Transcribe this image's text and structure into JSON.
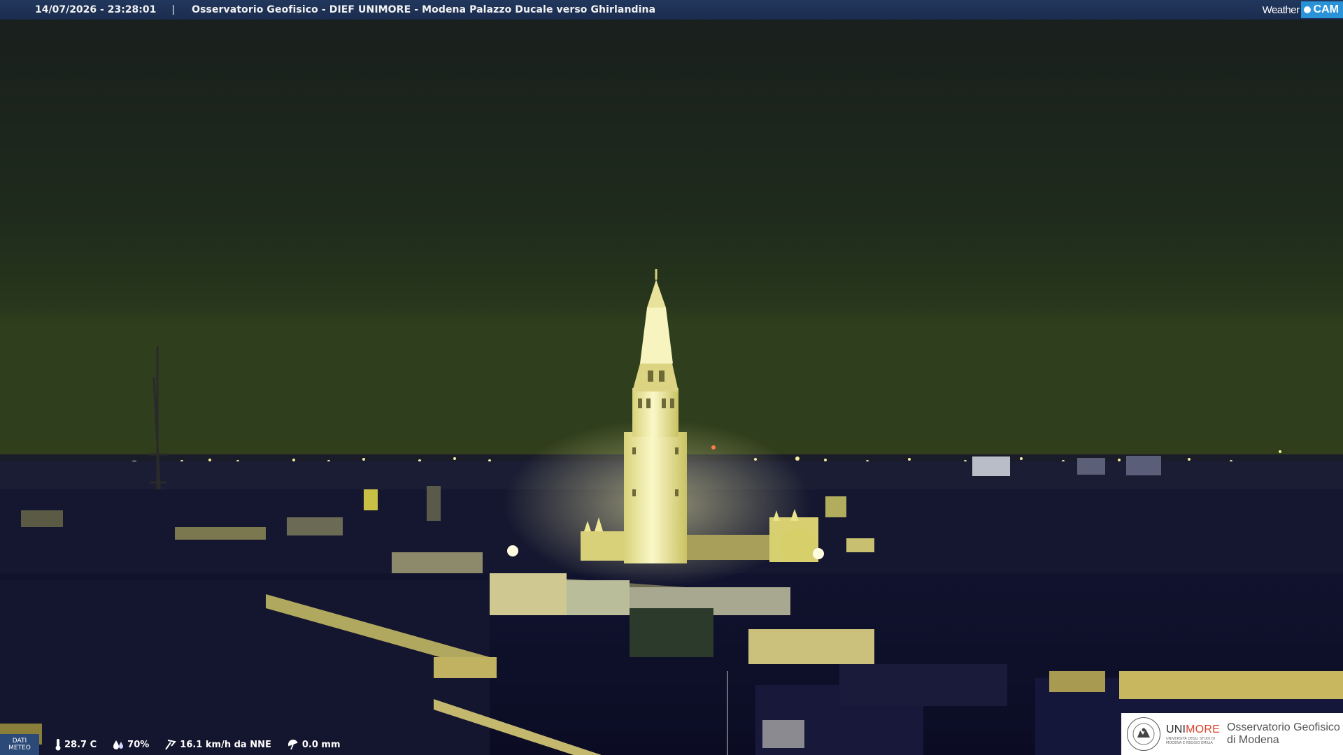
{
  "header": {
    "datetime": "14/07/2026 - 23:28:01",
    "separator": "|",
    "caption": "Osservatorio Geofisico - DIEF UNIMORE - Modena Palazzo Ducale verso Ghirlandina"
  },
  "brand": {
    "weather": "Weather",
    "cam": "CAM"
  },
  "meteo": {
    "label_line1": "DATI",
    "label_line2": "METEO",
    "temperature": "28.7 C",
    "humidity": "70%",
    "wind": "16.1 km/h da NNE",
    "rain": "0.0 mm"
  },
  "logo": {
    "uni_prefix": "UNI",
    "uni_suffix": "MORE",
    "uni_sub_line1": "UNIVERSITÀ DEGLI STUDI DI",
    "uni_sub_line2": "MODENA E REGGIO EMILIA",
    "observatory_line1": "Osservatorio Geofisico",
    "observatory_line2": "di Modena"
  },
  "colors": {
    "sky": "#1f2a1d",
    "tower_light": "#f6f29e",
    "roofs": "#0f1028",
    "top_bar": "#1f3356",
    "cam_blue": "#2a93d8",
    "unimore_red": "#d8432b"
  }
}
